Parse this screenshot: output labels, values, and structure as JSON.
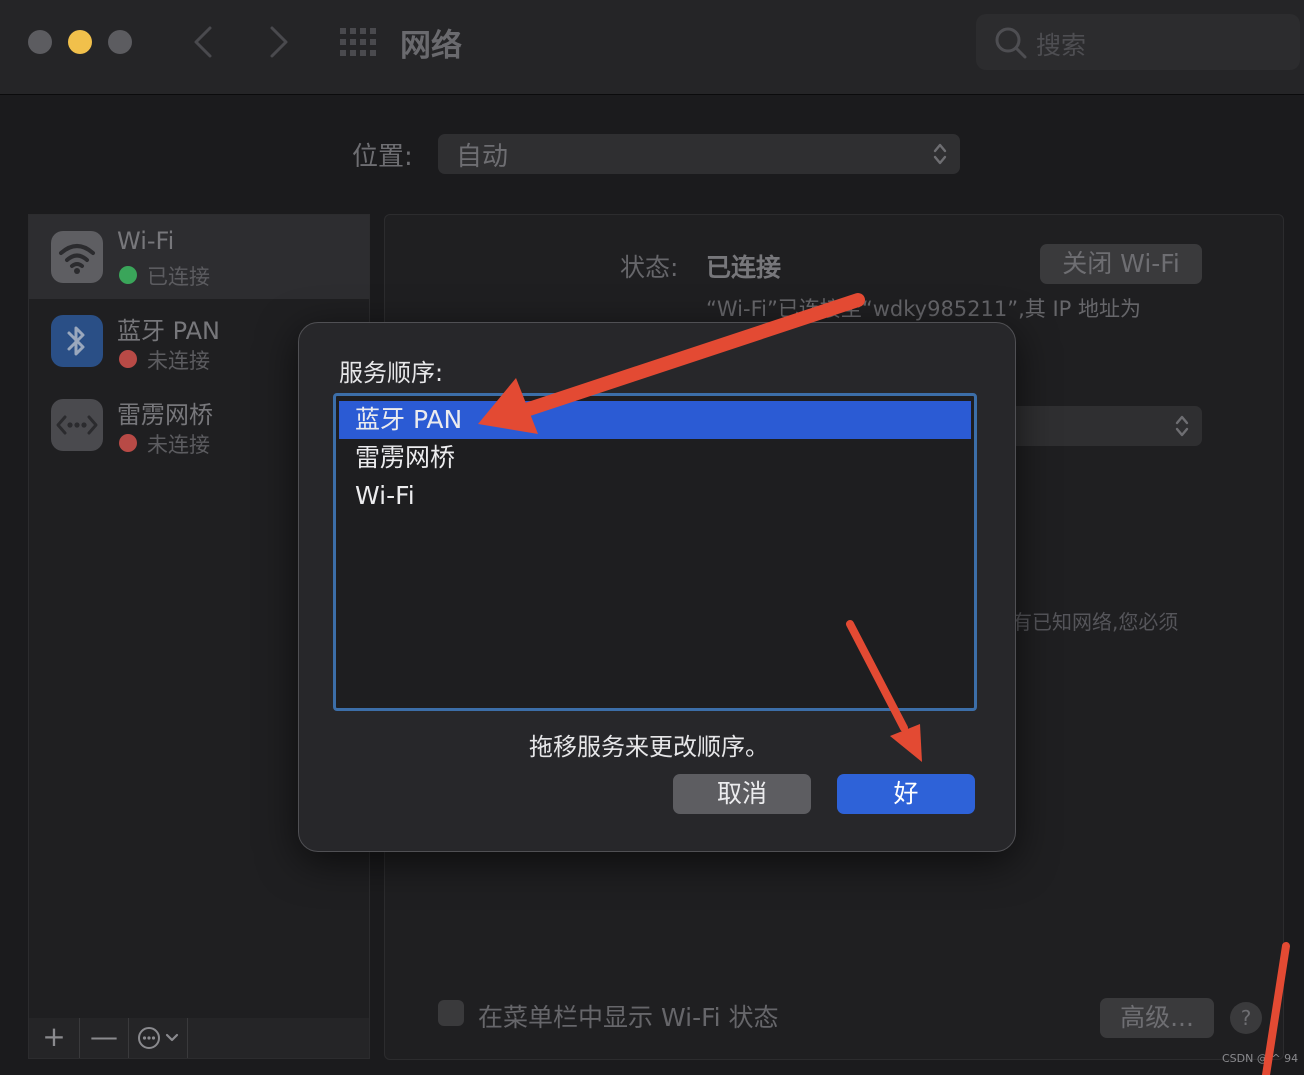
{
  "window": {
    "title": "网络",
    "search_placeholder": "搜索",
    "icons": [
      "back-chevron-icon",
      "forward-chevron-icon",
      "grid-icon",
      "search-icon"
    ]
  },
  "location": {
    "label": "位置:",
    "value": "自动"
  },
  "sidebar": {
    "services": [
      {
        "name": "Wi-Fi",
        "status": "已连接",
        "status_color": "#3aa55a",
        "icon": "wifi-icon",
        "selected": true
      },
      {
        "name": "蓝牙 PAN",
        "status": "未连接",
        "status_color": "#b84a46",
        "icon": "bluetooth-icon",
        "selected": false
      },
      {
        "name": "雷雳网桥",
        "status": "未连接",
        "status_color": "#b84a46",
        "icon": "thunderbolt-bridge-icon",
        "selected": false
      }
    ],
    "add_label": "+",
    "remove_label": "—"
  },
  "detail": {
    "status_label": "状态:",
    "status_value": "已连接",
    "turn_off_label": "关闭 Wi-Fi",
    "status_description": "“Wi-Fi”已连接至“wdky985211”,其 IP 地址为",
    "hint_fragment": "有已知网络,您必须",
    "show_in_menubar_label": "在菜单栏中显示 Wi-Fi 状态",
    "advanced_label": "高级...",
    "help_label": "?"
  },
  "dialog": {
    "title": "服务顺序:",
    "items": [
      "蓝牙 PAN",
      "雷雳网桥",
      "Wi-Fi"
    ],
    "selected_index": 0,
    "hint": "拖移服务来更改顺序。",
    "cancel_label": "取消",
    "ok_label": "好"
  },
  "watermark": "CSDN @ ^ 94",
  "colors": {
    "accent": "#2e62d8",
    "selection": "#2b5bd4",
    "annotation_arrow": "#e34a33",
    "traffic_yellow": "#f1c04b"
  }
}
